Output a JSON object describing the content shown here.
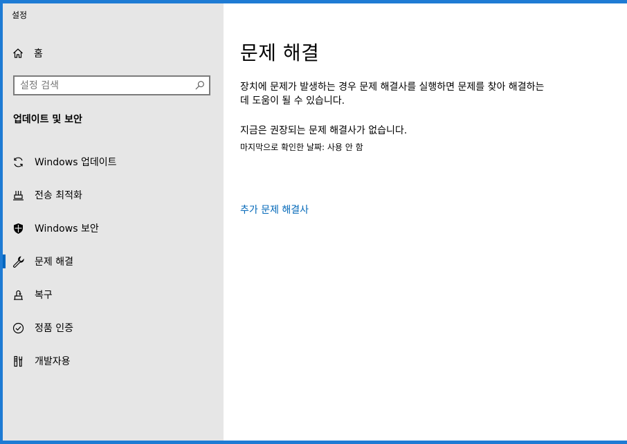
{
  "window": {
    "title": "설정"
  },
  "sidebar": {
    "home_label": "홈",
    "search_placeholder": "설정 검색",
    "section_title": "업데이트 및 보안",
    "items": [
      {
        "label": "Windows 업데이트",
        "icon": "sync-icon",
        "selected": false
      },
      {
        "label": "전송 최적화",
        "icon": "delivery-optimization-icon",
        "selected": false
      },
      {
        "label": "Windows 보안",
        "icon": "shield-icon",
        "selected": false
      },
      {
        "label": "문제 해결",
        "icon": "wrench-icon",
        "selected": true
      },
      {
        "label": "복구",
        "icon": "recovery-icon",
        "selected": false
      },
      {
        "label": "정품 인증",
        "icon": "checkmark-circle-icon",
        "selected": false
      },
      {
        "label": "개발자용",
        "icon": "developer-tools-icon",
        "selected": false
      }
    ]
  },
  "main": {
    "title": "문제 해결",
    "description": "장치에 문제가 발생하는 경우 문제 해결사를 실행하면 문제를 찾아 해결하는 데 도움이 될 수 있습니다.",
    "status": "지금은 권장되는 문제 해결사가 없습니다.",
    "last_checked": "마지막으로 확인한 날짜: 사용 안 함",
    "additional_link": "추가 문제 해결사"
  },
  "colors": {
    "accent": "#0067c0",
    "link": "#0067b8",
    "sidebar_bg": "#e6e6e6",
    "desktop_border": "#1e7bd4"
  }
}
